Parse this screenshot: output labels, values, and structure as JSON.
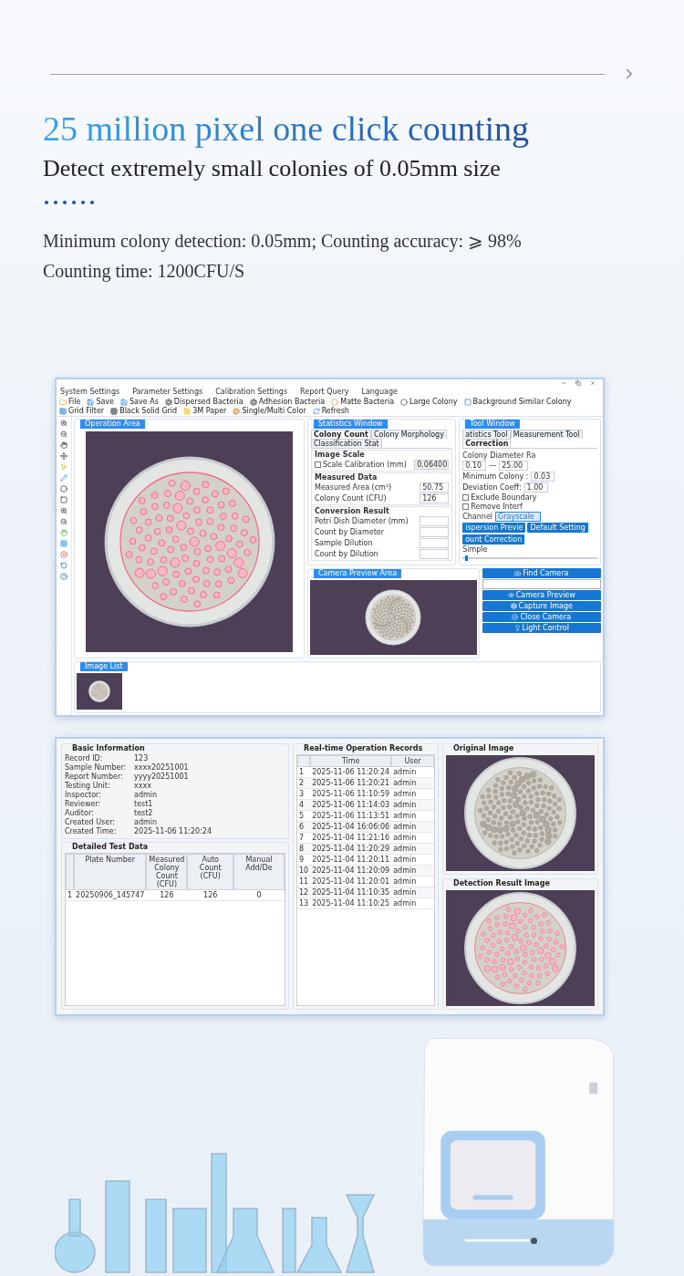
{
  "header": {
    "title": "25 million pixel one click counting",
    "subtitle": "Detect extremely small colonies of 0.05mm size",
    "specs": [
      "Minimum colony detection: 0.05mm; Counting accuracy: ⩾ 98%",
      "Counting time: 1200CFU/S"
    ]
  },
  "counting_window": {
    "menu": [
      "System Settings",
      "Parameter Settings",
      "Calibration Settings",
      "Report Query",
      "Language"
    ],
    "toolbar": [
      "File",
      "Save",
      "Save As",
      "Dispersed Bacteria",
      "Adhesion Bacteria",
      "Matte Bacteria",
      "Large Colony",
      "Background Similar Colony",
      "Grid Filter",
      "Black Solid Grid",
      "3M Paper",
      "Single/Multi Color",
      "Refresh"
    ],
    "operation_area": "Operation Area",
    "statistics": {
      "title": "Statistics Window",
      "tabs": [
        {
          "label": "Colony Count",
          "selected": true
        },
        {
          "label": "Colony Morphology",
          "selected": false
        },
        {
          "label": "Classification Stat",
          "selected": false
        }
      ],
      "groups": [
        {
          "title": "Image Scale",
          "fields": [
            {
              "kind": "check",
              "label": "Scale Calibration (mm)",
              "checked": false,
              "value": "0.06400"
            }
          ]
        },
        {
          "title": "Measured Data",
          "fields": [
            {
              "kind": "input",
              "label": "Measured Area (cm²)",
              "value": "50.75"
            },
            {
              "kind": "input",
              "label": "Colony Count (CFU)",
              "value": "126"
            }
          ]
        },
        {
          "title": "Conversion Result",
          "fields": [
            {
              "kind": "input",
              "label": "Petri Dish Diameter (mm)"
            },
            {
              "kind": "input",
              "label": "Count by Diameter"
            },
            {
              "kind": "input",
              "label": "Sample Dilution"
            },
            {
              "kind": "input",
              "label": "Count by Dilution"
            }
          ]
        }
      ]
    },
    "tools": {
      "title": "Tool Window",
      "tabs": [
        {
          "label": "atistics Tool",
          "selected": false
        },
        {
          "label": "Measurement Tool",
          "selected": false
        },
        {
          "label": "Correction",
          "selected": true
        }
      ],
      "diameter": {
        "label": "Colony Diameter Ra",
        "from": "0.10",
        "separator": "—",
        "to": "25.00"
      },
      "spins": [
        {
          "label": "Minimum Colony :",
          "value": "0.03"
        },
        {
          "label": "Deviation Coeff:",
          "value": "1.00"
        }
      ],
      "checks": [
        {
          "label": "Exclude Boundary",
          "checked": false
        },
        {
          "label": "Remove Interf",
          "checked": false
        }
      ],
      "channel": {
        "label": "Channel",
        "value": "Grayscale"
      },
      "buttons": [
        "ispersion Previe",
        "Default Setting",
        "ount Correction"
      ],
      "slider": {
        "label": "Simple",
        "level": 0.02
      }
    },
    "camera": {
      "title": "Camera Preview Area",
      "buttons": [
        "Find Camera",
        "Camera Preview",
        "Capture Image",
        "Close Camera",
        "Light Control"
      ]
    },
    "image_list": "Image List"
  },
  "report_window": {
    "basic": {
      "title": "Basic Information",
      "fields": [
        {
          "label": "Record ID:",
          "value": "123"
        },
        {
          "label": "Sample Number:",
          "value": "xxxx20251001"
        },
        {
          "label": "Report Number:",
          "value": "yyyy20251001"
        },
        {
          "label": "Testing Unit:",
          "value": "xxxx"
        },
        {
          "label": "Inspector:",
          "value": "admin"
        },
        {
          "label": "Reviewer:",
          "value": "test1"
        },
        {
          "label": "Auditor:",
          "value": "test2"
        },
        {
          "label": "Created User:",
          "value": "admin"
        },
        {
          "label": "Created Time:",
          "value": "2025-11-06 11:20:24"
        }
      ]
    },
    "detail": {
      "title": "Detailed Test Data",
      "columns": [
        "Plate Number",
        "Measured Colony Count (CFU)",
        "Auto Count (CFU)",
        "Manual Add/De"
      ],
      "rows": [
        {
          "index": "1",
          "cells": [
            "20250906_145747",
            "126",
            "126",
            "0"
          ]
        }
      ]
    },
    "records": {
      "title": "Real-time Operation Records",
      "columns": [
        "Time",
        "User"
      ],
      "rows": [
        {
          "index": "1",
          "time": "2025-11-06 11:20:24",
          "user": "admin"
        },
        {
          "index": "2",
          "time": "2025-11-06 11:20:21",
          "user": "admin"
        },
        {
          "index": "3",
          "time": "2025-11-06 11:10:59",
          "user": "admin"
        },
        {
          "index": "4",
          "time": "2025-11-06 11:14:03",
          "user": "admin"
        },
        {
          "index": "5",
          "time": "2025-11-06 11:13:51",
          "user": "admin"
        },
        {
          "index": "6",
          "time": "2025-11-04 16:06:06",
          "user": "admin"
        },
        {
          "index": "7",
          "time": "2025-11-04 11:21:16",
          "user": "admin"
        },
        {
          "index": "8",
          "time": "2025-11-04 11:20:29",
          "user": "admin"
        },
        {
          "index": "9",
          "time": "2025-11-04 11:20:11",
          "user": "admin"
        },
        {
          "index": "10",
          "time": "2025-11-04 11:20:09",
          "user": "admin"
        },
        {
          "index": "11",
          "time": "2025-11-04 11:20:01",
          "user": "admin"
        },
        {
          "index": "12",
          "time": "2025-11-04 11:10:35",
          "user": "admin"
        },
        {
          "index": "13",
          "time": "2025-11-04 11:10:25",
          "user": "admin"
        }
      ]
    },
    "images": [
      "Original Image",
      "Detection Result Image"
    ]
  }
}
